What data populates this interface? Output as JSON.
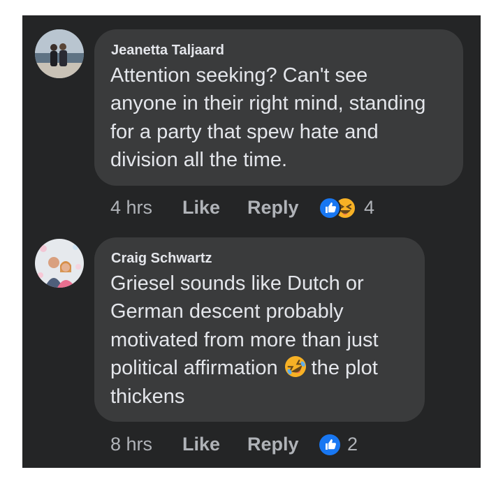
{
  "comments": [
    {
      "author": "Jeanetta Taljaard",
      "lines": [
        "Attention seeking? Can't see",
        "anyone in their right mind, standing",
        "for a party that spew hate and",
        "division all the time."
      ],
      "time": "4 hrs",
      "like_label": "Like",
      "reply_label": "Reply",
      "reaction_icons": [
        "like-icon",
        "laughing-icon"
      ],
      "reaction_count": "4"
    },
    {
      "author": "Craig Schwartz",
      "lines": [
        "Griesel sounds like Dutch or",
        "German descent probably",
        "motivated from more than just",
        "political affirmation",
        "the plot",
        "thickens"
      ],
      "inline_emoji": "rolling-on-floor-laughing-emoji",
      "time": "8 hrs",
      "like_label": "Like",
      "reply_label": "Reply",
      "reaction_icons": [
        "like-icon"
      ],
      "reaction_count": "2"
    }
  ],
  "colors": {
    "background": "#242526",
    "bubble": "#3a3b3c",
    "text": "#e4e6eb",
    "meta": "#b0b3b8",
    "like_blue": "#1877f2",
    "haha_yellow": "#f7b125"
  }
}
